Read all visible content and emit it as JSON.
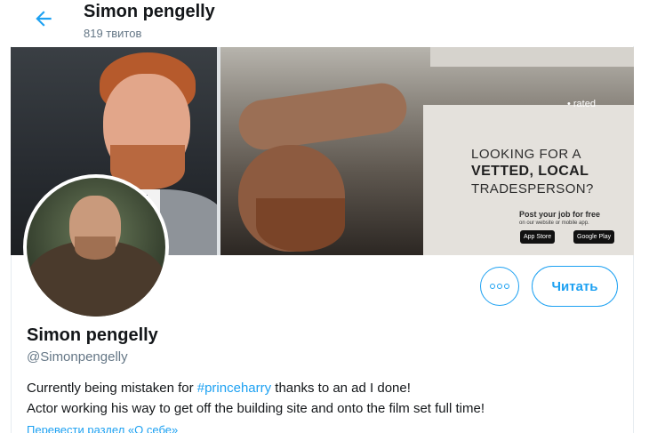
{
  "header": {
    "back_icon": "arrow-left-icon",
    "title": "Simon pengelly",
    "tweet_count": "819 твитов"
  },
  "banner": {
    "ad_logo": "rated",
    "ad_line1": "LOOKING FOR A",
    "ad_line2": "VETTED, LOCAL",
    "ad_line3": "TRADESPERSON?",
    "ad_post": "Post your job for free",
    "ad_post_sub": "on our website or mobile app.",
    "badge_apple": "App Store",
    "badge_google": "Google Play"
  },
  "actions": {
    "more_icon": "more-dots-icon",
    "follow_label": "Читать"
  },
  "profile": {
    "display_name": "Simon pengelly",
    "handle": "@Simonpengelly",
    "bio_prefix": "Currently being mistaken for ",
    "bio_hashtag": "#princeharry",
    "bio_suffix": " thanks to an ad I done!",
    "bio_line2": " Actor working his way to get off the building site and onto the film set full time!",
    "translate_link": "Перевести раздел «О себе»"
  },
  "colors": {
    "accent": "#1da1f2",
    "secondary_text": "#657786",
    "primary_text": "#14171a"
  }
}
